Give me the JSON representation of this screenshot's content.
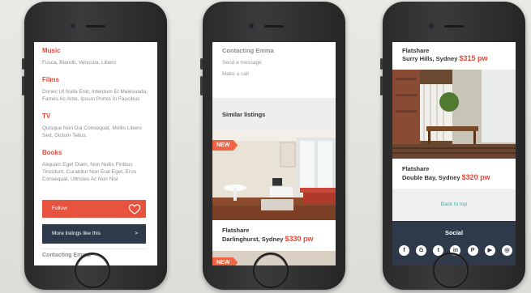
{
  "phone1": {
    "sections": [
      {
        "title": "Music",
        "text": "Fusca, Blandit, Vehicula, Libero"
      },
      {
        "title": "Films",
        "text": "Donec Ut Nulla Erat, Interdum Et Malesuada, Fames Ac Ante, Ipsum Primis In Faucibus"
      },
      {
        "title": "TV",
        "text": "Quisque Non Dui Consequat, Mollis Libero Sed, Dictum Tellus."
      },
      {
        "title": "Books",
        "text": "Aliquam Eget Diam, Non Nullis Finibus Tincidunt, Curabitur Non Erat Eget, Eros Consequat, Ultricies Ac Non Nisl"
      }
    ],
    "follow_label": "Follow",
    "more_label": "More listings like this",
    "more_arrow": ">",
    "contact_title": "Contacting Emma"
  },
  "phone2": {
    "contact_title": "Contacting Emma",
    "send_message": "Send a message",
    "make_call": "Make a call",
    "similar_title": "Similar listings",
    "badge": "NEW",
    "listing": {
      "type": "Flatshare",
      "location": "Darlinghurst, Sydney",
      "price": "$330 pw"
    },
    "badge2": "NEW"
  },
  "phone3": {
    "listing_top": {
      "type": "Flatshare",
      "location": "Surry Hills, Sydney",
      "price": "$315 pw"
    },
    "listing_bottom": {
      "type": "Flatshare",
      "location": "Double Bay, Sydney",
      "price": "$320 pw"
    },
    "back_to_top": "Back to top",
    "social_title": "Social",
    "social_icons": [
      "facebook-icon",
      "google-plus-icon",
      "twitter-icon",
      "linkedin-icon",
      "pinterest-icon",
      "youtube-icon",
      "instagram-icon"
    ]
  },
  "colors": {
    "accent": "#e8483a",
    "dark": "#2e3a4a",
    "teal": "#3ab5a8"
  }
}
